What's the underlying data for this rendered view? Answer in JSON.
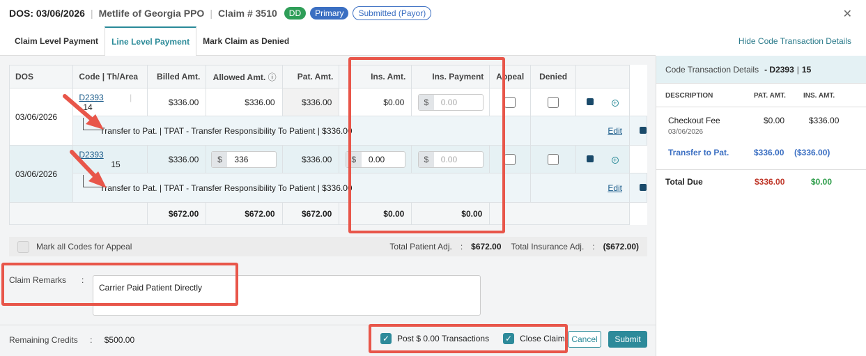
{
  "header": {
    "dos": "DOS: 03/06/2026",
    "carrier": "Metlife of Georgia PPO",
    "claim_no": "Claim # 3510",
    "badges": [
      "DD",
      "Primary",
      "Submitted (Payor)"
    ]
  },
  "tabs": [
    "Claim Level Payment",
    "Line Level Payment",
    "Mark Claim as Denied"
  ],
  "hide_link": "Hide Code Transaction Details",
  "table": {
    "columns": [
      "DOS",
      "Code",
      "Th/Area",
      "Billed Amt.",
      "Allowed Amt.",
      "Pat. Amt.",
      "Ins. Amt.",
      "Ins. Payment",
      "Appeal",
      "Denied"
    ],
    "rows": [
      {
        "dos": "03/06/2026",
        "code": "D2393",
        "tooth": "14",
        "billed": "$336.00",
        "allowed": "$336.00",
        "pat": "$336.00",
        "ins": "$0.00",
        "cur": "$",
        "ins_payment_placeholder": "0.00",
        "transfer": "Transfer to Pat. | TPAT - Transfer Responsibility To Patient | $336.00",
        "edit": "Edit"
      },
      {
        "dos": "03/06/2026",
        "code": "D2393",
        "tooth": "15",
        "billed": "$336.00",
        "allowed_value": "336",
        "pat": "$336.00",
        "ins_value": "0.00",
        "cur": "$",
        "ins_payment_placeholder": "0.00",
        "transfer": "Transfer to Pat. | TPAT - Transfer Responsibility To Patient | $336.00",
        "edit": "Edit"
      }
    ],
    "totals": {
      "billed": "$672.00",
      "allowed": "$672.00",
      "pat": "$672.00",
      "ins": "$0.00",
      "ins_payment": "$0.00"
    }
  },
  "appeal": {
    "label": "Mark all Codes for Appeal",
    "total_patient_label": "Total Patient Adj.",
    "total_patient": "$672.00",
    "total_insurance_label": "Total Insurance Adj.",
    "total_insurance": "($672.00)",
    "colon": ":"
  },
  "remarks": {
    "label": "Claim Remarks",
    "colon": ":",
    "value": "Carrier Paid Patient Directly"
  },
  "footer": {
    "credits_label": "Remaining Credits",
    "credits_colon": ":",
    "credits_value": "$500.00",
    "post_label": "Post $ 0.00 Transactions",
    "close_label": "Close Claim",
    "cancel": "Cancel",
    "submit": "Submit"
  },
  "right_panel": {
    "title": "Code Transaction Details",
    "code": "- D2393",
    "sep": "|",
    "tooth": "15",
    "col_description": "DESCRIPTION",
    "col_pat": "PAT. AMT.",
    "col_ins": "INS. AMT.",
    "checkout_label": "Checkout Fee",
    "checkout_date": "03/06/2026",
    "checkout_pat": "$0.00",
    "checkout_ins": "$336.00",
    "transfer_label": "Transfer to Pat.",
    "transfer_pat": "$336.00",
    "transfer_ins": "($336.00)",
    "total_label": "Total Due",
    "total_pat": "$336.00",
    "total_ins": "$0.00"
  },
  "colors": {
    "accent": "#2a8a98",
    "highlight": "#e8564a",
    "primary_blue": "#3b6fc2",
    "green": "#2e9d4a",
    "red": "#c0392b"
  }
}
